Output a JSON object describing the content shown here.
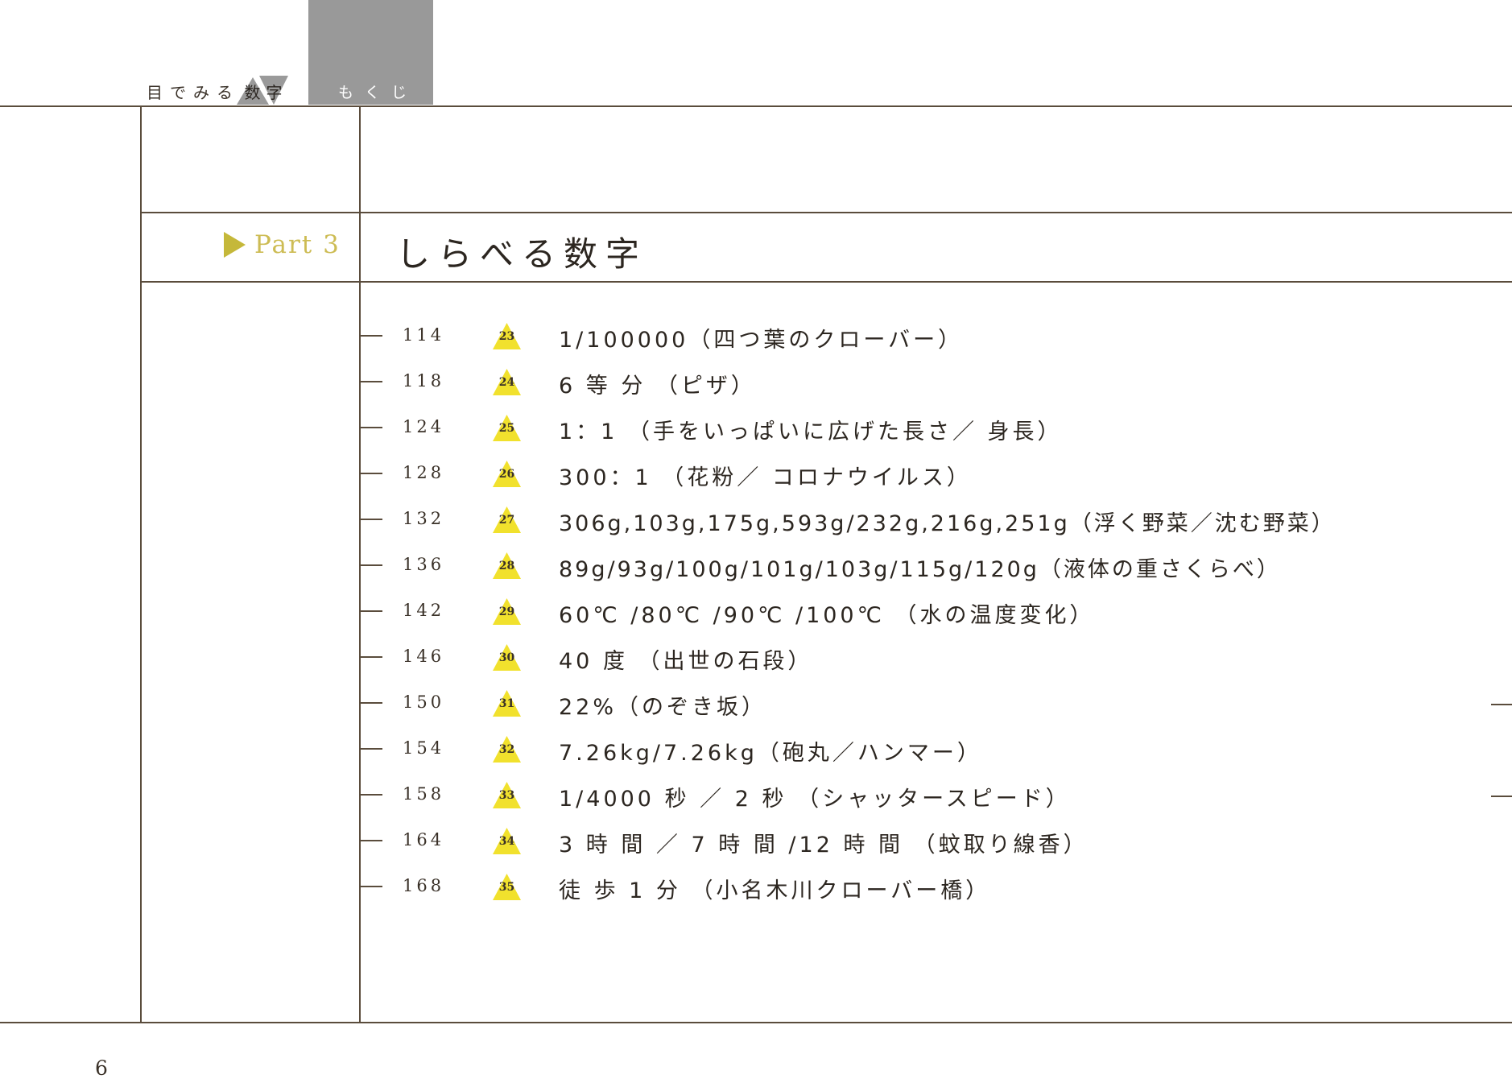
{
  "header": {
    "book_title_prefix": "目でみる",
    "book_title_mark_chars": [
      "数",
      "字"
    ],
    "section_tab": "もくじ"
  },
  "part": {
    "label": "Part 3",
    "title": "しらべる数字"
  },
  "toc": [
    {
      "page": "114",
      "number": "23",
      "text": "1/100000（四つ葉のクローバー）"
    },
    {
      "page": "118",
      "number": "24",
      "text": "6 等 分 （ピザ）"
    },
    {
      "page": "124",
      "number": "25",
      "text": "1：1 （手をいっぱいに広げた長さ／ 身長）"
    },
    {
      "page": "128",
      "number": "26",
      "text": "300：1 （花粉／ コロナウイルス）"
    },
    {
      "page": "132",
      "number": "27",
      "text": "306g,103g,175g,593g/232g,216g,251g（浮く野菜／沈む野菜）"
    },
    {
      "page": "136",
      "number": "28",
      "text": "89g/93g/100g/101g/103g/115g/120g（液体の重さくらべ）"
    },
    {
      "page": "142",
      "number": "29",
      "text": "60℃ /80℃ /90℃ /100℃ （水の温度変化）"
    },
    {
      "page": "146",
      "number": "30",
      "text": "40 度 （出世の石段）"
    },
    {
      "page": "150",
      "number": "31",
      "text": "22%（のぞき坂）"
    },
    {
      "page": "154",
      "number": "32",
      "text": "7.26kg/7.26kg（砲丸／ハンマー）"
    },
    {
      "page": "158",
      "number": "33",
      "text": "1/4000 秒 ／ 2 秒 （シャッタースピード）"
    },
    {
      "page": "164",
      "number": "34",
      "text": "3 時 間 ／ 7 時 間 /12 時 間 （蚊取り線香）"
    },
    {
      "page": "168",
      "number": "35",
      "text": "徒 歩 1 分 （小名木川クローバー橋）"
    }
  ],
  "page_number": "6",
  "colors": {
    "accent_yellow": "#f1e12d",
    "part_label": "#cdbc54",
    "rule_line": "#5a4c3c",
    "header_tab": "#999999"
  }
}
